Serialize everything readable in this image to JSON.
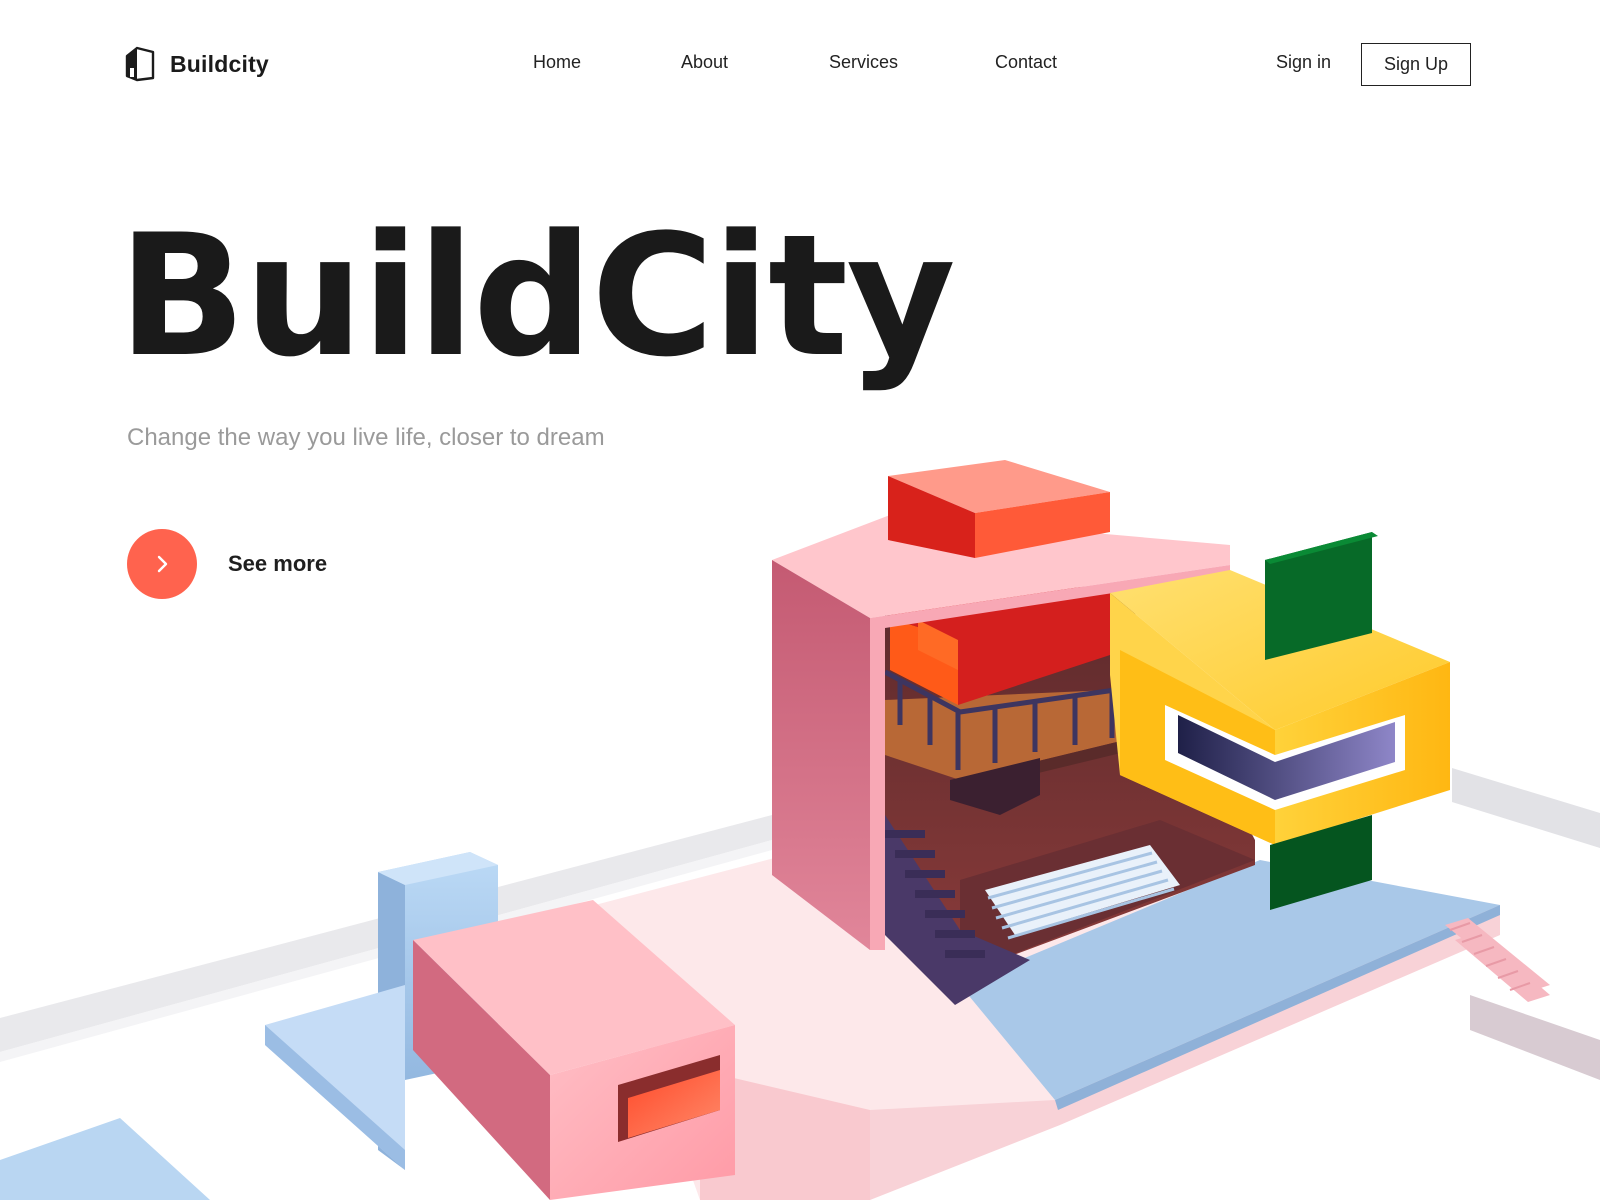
{
  "brand": {
    "name": "Buildcity",
    "logo_icon": "house-logo-icon"
  },
  "nav": {
    "items": [
      {
        "label": "Home"
      },
      {
        "label": "About"
      },
      {
        "label": "Services"
      },
      {
        "label": "Contact"
      }
    ]
  },
  "auth": {
    "signin_label": "Sign in",
    "signup_label": "Sign Up"
  },
  "hero": {
    "title": "BuildCity",
    "subtitle": "Change the way you live life, closer to dream",
    "cta_label": "See more",
    "cta_icon": "chevron-right-icon"
  },
  "colors": {
    "accent": "#ff634e",
    "pink": "#f7a9b3",
    "yellow": "#ffc524",
    "green": "#0f7a2f",
    "blue": "#a9cbef"
  },
  "illustration": {
    "icon": "isometric-house-illustration"
  }
}
